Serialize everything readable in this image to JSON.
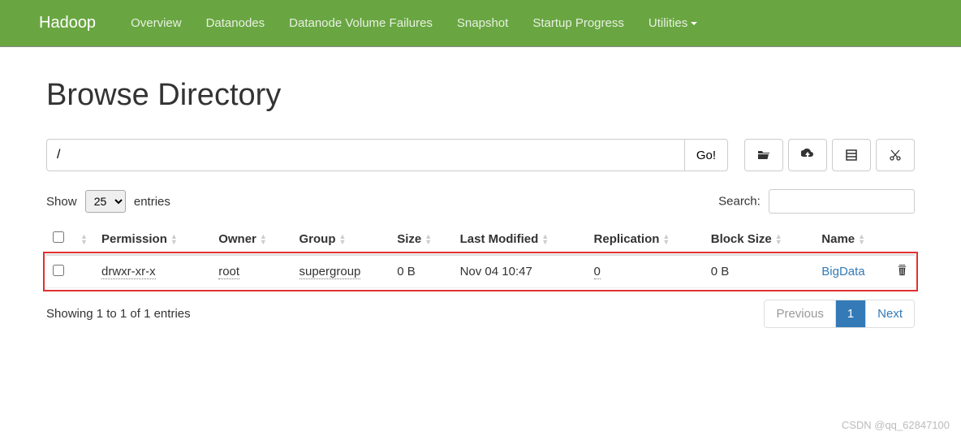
{
  "navbar": {
    "brand": "Hadoop",
    "items": [
      "Overview",
      "Datanodes",
      "Datanode Volume Failures",
      "Snapshot",
      "Startup Progress",
      "Utilities"
    ]
  },
  "page": {
    "title": "Browse Directory"
  },
  "path": {
    "value": "/",
    "go_label": "Go!"
  },
  "toolbar": {
    "new_folder": "new-folder",
    "upload": "upload",
    "list_view": "list-view",
    "cut": "cut"
  },
  "table_controls": {
    "show_label": "Show",
    "entries_label": "entries",
    "page_size": "25",
    "search_label": "Search:",
    "search_value": ""
  },
  "columns": [
    "Permission",
    "Owner",
    "Group",
    "Size",
    "Last Modified",
    "Replication",
    "Block Size",
    "Name"
  ],
  "rows": [
    {
      "permission": "drwxr-xr-x",
      "owner": "root",
      "group": "supergroup",
      "size": "0 B",
      "last_modified": "Nov 04 10:47",
      "replication": "0",
      "block_size": "0 B",
      "name": "BigData"
    }
  ],
  "footer": {
    "info": "Showing 1 to 1 of 1 entries",
    "prev": "Previous",
    "next": "Next",
    "current_page": "1"
  },
  "watermark": "CSDN @qq_62847100"
}
